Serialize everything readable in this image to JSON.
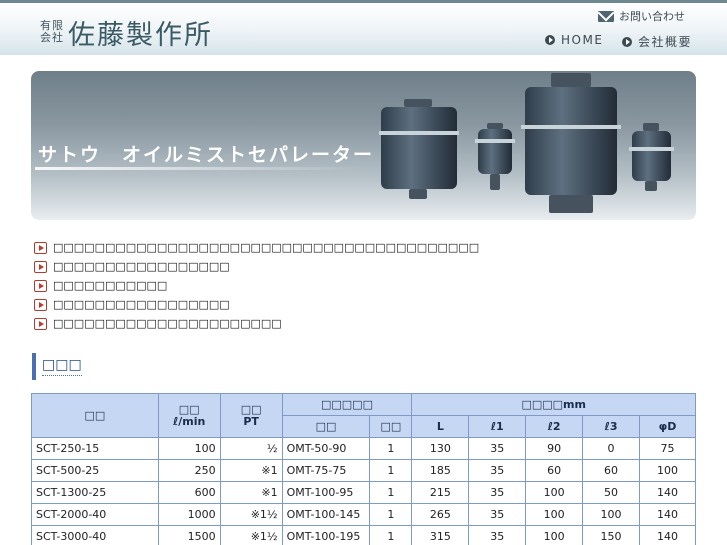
{
  "header": {
    "logo_small_top": "有限",
    "logo_small_bottom": "会社",
    "logo_main": "佐藤製作所",
    "contact_label": "お問い合わせ",
    "nav": [
      {
        "label": "HOME",
        "icon": "arrow-circle-icon"
      },
      {
        "label": "会社概要",
        "icon": "arrow-circle-icon"
      }
    ],
    "accent_color": "#3a5a66"
  },
  "banner": {
    "title": "サトウ　オイルミストセパレーター"
  },
  "bullets": [
    "□□□□□□□□□□□□□□□□□□□□□□□□□□□□□□□□□□□□□□□□□",
    "□□□□□□□□□□□□□□□□□",
    "□□□□□□□□□□□",
    "□□□□□□□□□□□□□□□□□",
    "□□□□□□□□□□□□□□□□□□□□□□"
  ],
  "section_title": "□□□",
  "table": {
    "headers": {
      "model": "□□",
      "flow_top": "□□",
      "flow_unit": "ℓ/min",
      "pt_top": "□□",
      "pt_unit": "PT",
      "element_group": "□□□□□",
      "element_model": "□□",
      "element_qty": "□□",
      "dims_group": "□□□□mm",
      "dims": [
        "L",
        "ℓ1",
        "ℓ2",
        "ℓ3",
        "φD"
      ]
    },
    "rows": [
      {
        "model": "SCT-250-15",
        "flow": "100",
        "pt": "½",
        "el_model": "OMT-50-90",
        "qty": "1",
        "L": "130",
        "l1": "35",
        "l2": "90",
        "l3": "0",
        "D": "75"
      },
      {
        "model": "SCT-500-25",
        "flow": "250",
        "pt": "※1",
        "el_model": "OMT-75-75",
        "qty": "1",
        "L": "185",
        "l1": "35",
        "l2": "60",
        "l3": "60",
        "D": "100"
      },
      {
        "model": "SCT-1300-25",
        "flow": "600",
        "pt": "※1",
        "el_model": "OMT-100-95",
        "qty": "1",
        "L": "215",
        "l1": "35",
        "l2": "100",
        "l3": "50",
        "D": "140"
      },
      {
        "model": "SCT-2000-40",
        "flow": "1000",
        "pt": "※1½",
        "el_model": "OMT-100-145",
        "qty": "1",
        "L": "265",
        "l1": "35",
        "l2": "100",
        "l3": "100",
        "D": "140"
      },
      {
        "model": "SCT-3000-40",
        "flow": "1500",
        "pt": "※1½",
        "el_model": "OMT-100-195",
        "qty": "1",
        "L": "315",
        "l1": "35",
        "l2": "100",
        "l3": "150",
        "D": "140"
      }
    ]
  }
}
